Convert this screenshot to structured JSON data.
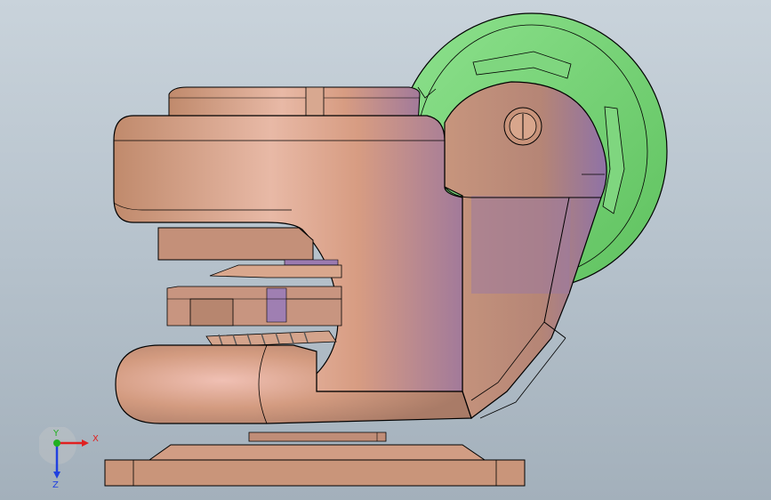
{
  "viewport": {
    "background_top": "#c9d3db",
    "background_bottom": "#a3b0bb"
  },
  "model": {
    "body_color": "#c9957a",
    "body_shadow": "#8e7aa6",
    "wheel_color": "#7fd67f",
    "wheel_dark": "#5fb85f",
    "edge_color": "#000000"
  },
  "triad": {
    "x_label": "X",
    "y_label": "Y",
    "z_label": "Z",
    "x_color": "#e02020",
    "y_color": "#20b020",
    "z_color": "#2040e0"
  }
}
